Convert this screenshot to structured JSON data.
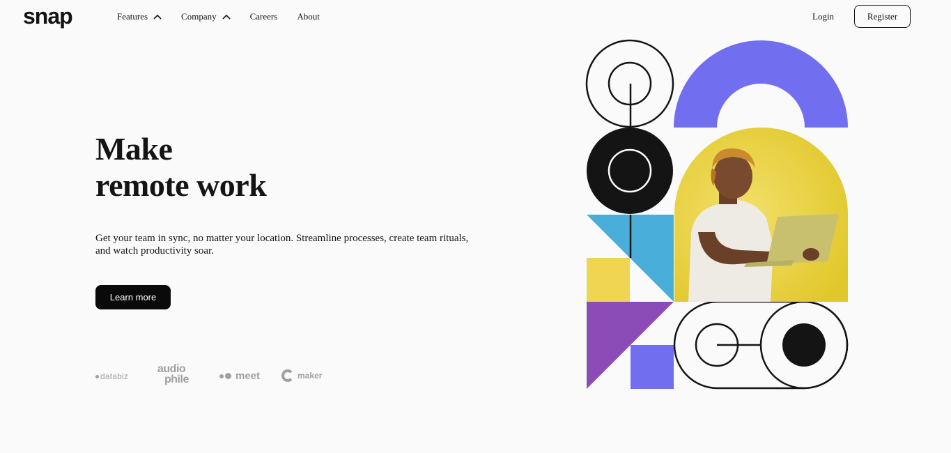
{
  "header": {
    "logo": "snap",
    "nav": [
      {
        "label": "Features"
      },
      {
        "label": "Company"
      },
      {
        "label": "Careers"
      },
      {
        "label": "About"
      }
    ],
    "login_label": "Login",
    "register_label": "Register"
  },
  "hero": {
    "title_line1": "Make",
    "title_line2": "remote work",
    "description": "Get your team in sync, no matter your location. Streamline processes, create team rituals, and watch productivity soar.",
    "cta_label": "Learn more"
  },
  "clients": {
    "databiz": "databiz",
    "audiophile_line1": "audio",
    "audiophile_line2": "phile",
    "meet": "meet",
    "maker": "maker"
  },
  "colors": {
    "background": "#fafafa",
    "text": "#141414",
    "button": "#0a0a0a",
    "purple": "#726ef0",
    "violet": "#8b4cb8",
    "blue": "#4aaedb",
    "yellow": "#f0d553",
    "photo_yellow": "#e6cf37"
  },
  "icons": {
    "nav_dropdown": "chevron-up-icon"
  }
}
